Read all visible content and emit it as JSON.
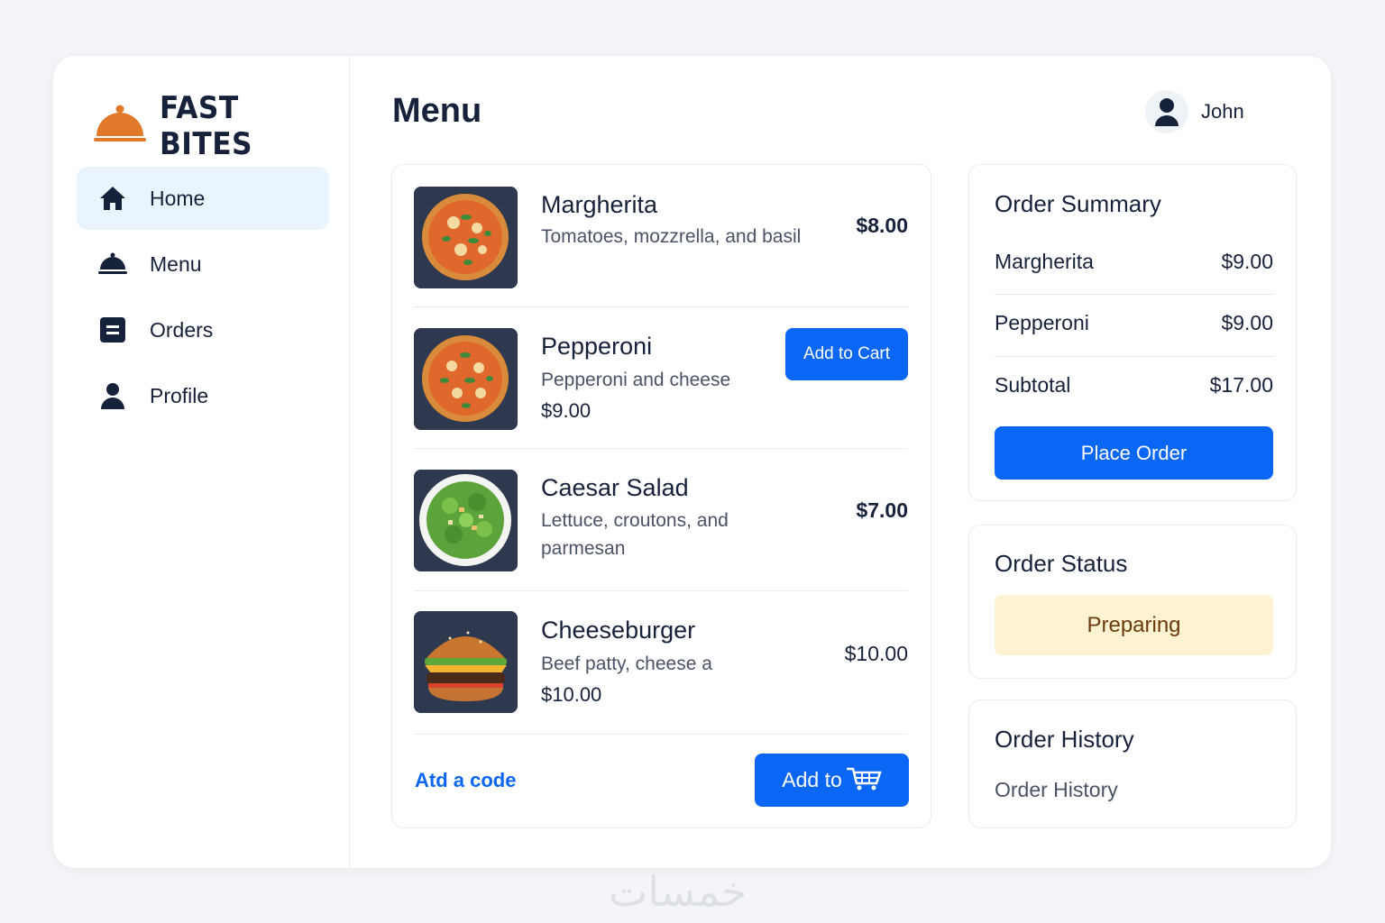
{
  "brand": {
    "name": "FAST BITES",
    "logo_icon": "cloche-icon",
    "logo_color": "#e07a2a"
  },
  "sidebar": {
    "items": [
      {
        "label": "Home",
        "icon": "home-icon",
        "active": true
      },
      {
        "label": "Menu",
        "icon": "cloche-icon",
        "active": false
      },
      {
        "label": "Orders",
        "icon": "orders-icon",
        "active": false
      },
      {
        "label": "Profile",
        "icon": "user-icon",
        "active": false
      }
    ]
  },
  "header": {
    "title": "Menu",
    "user_name": "John",
    "avatar_icon": "user-icon"
  },
  "menu": {
    "items": [
      {
        "name": "Margherita",
        "description": "Tomatoes, mozzrella, and basil",
        "price": "$8.00",
        "image": "pizza-image"
      },
      {
        "name": "Pepperoni",
        "description": "Pepperoni and cheese",
        "price": "$9.00",
        "button_label": "Add to Cart",
        "image": "pizza-image"
      },
      {
        "name": "Caesar Salad",
        "description": "Lettuce, croutons, and parmesan",
        "price": "$7.00",
        "image": "salad-image"
      },
      {
        "name": "Cheeseburger",
        "description": "Beef patty, cheese a",
        "price": "$10.00",
        "sub_price": "$10.00",
        "image": "burger-image"
      }
    ],
    "code_link": "Atd a code",
    "footer_button_label": "Add to",
    "footer_button_icon": "cart-icon"
  },
  "order_summary": {
    "title": "Order Summary",
    "rows": [
      {
        "label": "Margherita",
        "value": "$9.00"
      },
      {
        "label": "Pepperoni",
        "value": "$9.00"
      },
      {
        "label": "Subtotal",
        "value": "$17.00"
      }
    ],
    "button_label": "Place Order"
  },
  "order_status": {
    "title": "Order Status",
    "status": "Preparing",
    "status_bg": "#fdf3d3"
  },
  "order_history": {
    "title": "Order History",
    "text": "Order History"
  },
  "colors": {
    "accent": "#0a66f5",
    "text": "#16213a",
    "background": "#f4f5f8"
  },
  "watermark": "خمسات"
}
